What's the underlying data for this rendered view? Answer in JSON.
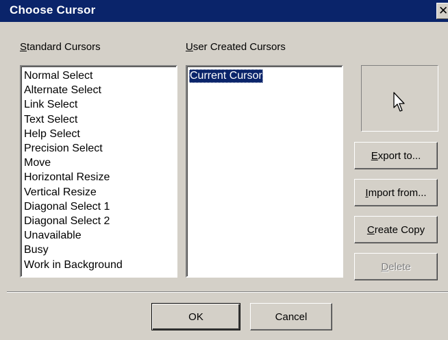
{
  "window": {
    "title": "Choose Cursor",
    "close_glyph": "✕"
  },
  "standard": {
    "label_key": "S",
    "label_rest": "tandard Cursors",
    "items": [
      "Normal Select",
      "Alternate Select",
      "Link Select",
      "Text Select",
      "Help Select",
      "Precision Select",
      "Move",
      "Horizontal Resize",
      "Vertical Resize",
      "Diagonal Select 1",
      "Diagonal Select 2",
      "Unavailable",
      "Busy",
      "Work in Background"
    ]
  },
  "user": {
    "label_key": "U",
    "label_rest": "ser Created Cursors",
    "items": [
      "Current Cursor"
    ],
    "selected_index": 0
  },
  "preview": {
    "icon": "arrow-cursor-icon"
  },
  "buttons": {
    "export": {
      "key": "E",
      "rest": "xport to..."
    },
    "import": {
      "key": "I",
      "rest": "mport from..."
    },
    "create": {
      "key": "C",
      "rest": "reate Copy"
    },
    "delete": {
      "key": "D",
      "rest": "elete",
      "enabled": false
    },
    "ok": "OK",
    "cancel": "Cancel"
  },
  "colors": {
    "titlebar": "#0a246a",
    "face": "#d4d0c8",
    "selection": "#0a246a"
  }
}
